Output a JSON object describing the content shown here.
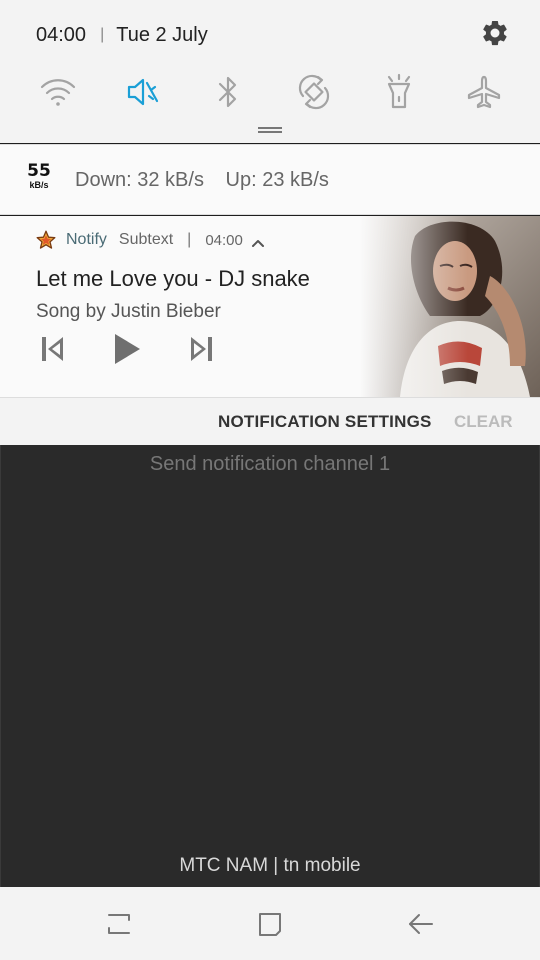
{
  "status": {
    "time": "04:00",
    "date": "Tue 2 July"
  },
  "quick_settings": [
    {
      "name": "wifi",
      "icon": "wifi-icon",
      "active": false
    },
    {
      "name": "sound",
      "icon": "mute-icon",
      "active": true
    },
    {
      "name": "bluetooth",
      "icon": "bluetooth-icon",
      "active": false
    },
    {
      "name": "auto-rotate",
      "icon": "rotate-icon",
      "active": false
    },
    {
      "name": "flashlight",
      "icon": "flashlight-icon",
      "active": false
    },
    {
      "name": "airplane",
      "icon": "airplane-icon",
      "active": false
    }
  ],
  "speed": {
    "badge_value": "55",
    "badge_unit": "kB/s",
    "down": "Down: 32 kB/s",
    "up": "Up: 23 kB/s"
  },
  "media": {
    "app_name": "Notify",
    "subtext": "Subtext",
    "time": "04:00",
    "title": "Let me Love you - DJ snake",
    "artist": "Song by Justin Bieber"
  },
  "actions": {
    "settings": "NOTIFICATION SETTINGS",
    "clear": "CLEAR"
  },
  "background_app": {
    "channel_text": "Send notification channel 1",
    "carrier": "MTC NAM | tn mobile"
  },
  "colors": {
    "accent": "#1a9fd6",
    "icon_gray": "#9a9a9a"
  }
}
